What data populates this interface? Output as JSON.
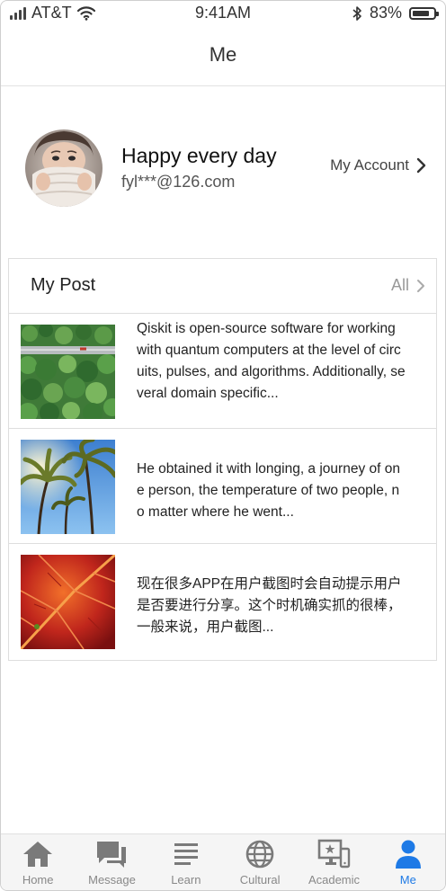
{
  "status_bar": {
    "carrier": "AT&T",
    "time": "9:41AM",
    "battery": "83%",
    "battery_level": 0.83
  },
  "nav": {
    "title": "Me"
  },
  "profile": {
    "name": "Happy every day",
    "email": "fyl***@126.com",
    "account_link": "My Account"
  },
  "posts": {
    "title": "My Post",
    "all_label": "All",
    "items": [
      {
        "image": "forest-road-aerial",
        "text": "Qiskit is open-source software for working with quantum computers at the level of circuits, pulses, and algorithms. Additionally, several domain specific..."
      },
      {
        "image": "palm-trees-sky",
        "text": "He obtained it with longing, a journey of one person, the temperature of two people, no matter where he went..."
      },
      {
        "image": "red-autumn-leaf",
        "text": "现在很多APP在用户截图时会自动提示用户是否要进行分享。这个时机确实抓的很棒，一般来说，用户截图..."
      }
    ]
  },
  "tabs": [
    {
      "label": "Home",
      "icon": "home-icon",
      "active": false
    },
    {
      "label": "Message",
      "icon": "message-icon",
      "active": false
    },
    {
      "label": "Learn",
      "icon": "learn-icon",
      "active": false
    },
    {
      "label": "Cultural",
      "icon": "globe-icon",
      "active": false
    },
    {
      "label": "Academic",
      "icon": "academic-icon",
      "active": false
    },
    {
      "label": "Me",
      "icon": "person-icon",
      "active": true
    }
  ],
  "colors": {
    "accent": "#1e7ae6",
    "tab_inactive": "#888888",
    "tab_icon_inactive": "#7a7a7a"
  }
}
